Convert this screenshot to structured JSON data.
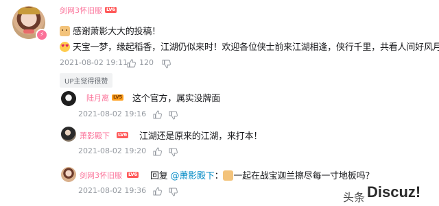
{
  "comment": {
    "username": "剑网3怀旧服",
    "level": "LV6",
    "line1": "感谢萧影大大的投稿！",
    "line2": "天宝一梦，缘起稻香，江湖仍似来时！欢迎各位侠士前来江湖相逢，侠行千里，共看人间好风月！",
    "date": "2021-08-02 19:11",
    "likes": "120",
    "tag": "UP主觉得很赞"
  },
  "replies": [
    {
      "username": "陆月离",
      "level": "LV5",
      "text": "这个官方，属实没牌面",
      "date": "2021-08-02 19:16"
    },
    {
      "username": "萧影殿下",
      "level": "LV6",
      "text": "江湖还是原来的江湖，来打本！",
      "date": "2021-08-02 19:20"
    },
    {
      "username": "剑网3怀旧服",
      "level": "LV6",
      "reply_label": "回复",
      "mention": "@萧影殿下",
      "colon": "：",
      "text": "一起在战宝迦兰擦尽每一寸地板吗？",
      "date": "2021-08-02 19:36"
    }
  ],
  "watermark": {
    "platform": "头条",
    "logo": "Discuz!"
  },
  "colors": {
    "username_pink": "#fb7299",
    "meta_gray": "#9499a0",
    "mention_blue": "#008ac5",
    "lv6": "#ff5a5a",
    "lv5": "#ff9f1c"
  }
}
